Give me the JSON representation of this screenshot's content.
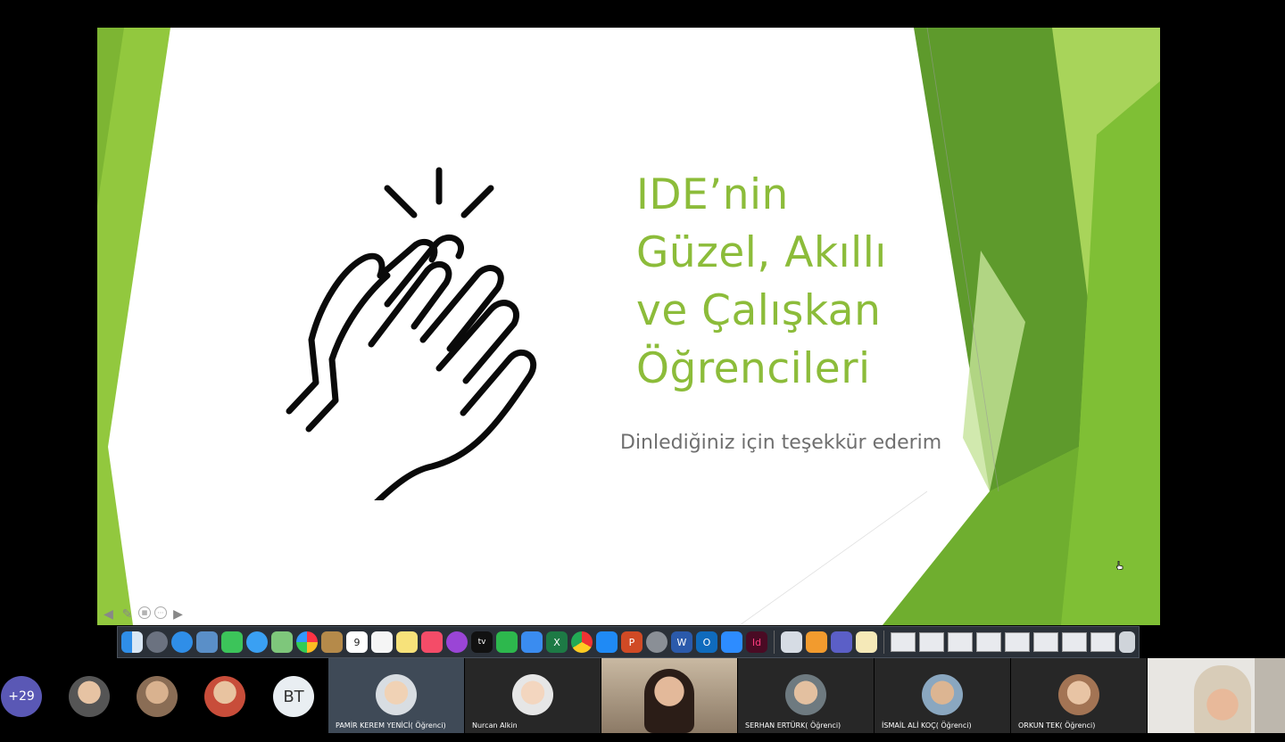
{
  "slide": {
    "title_lines": [
      "IDE’nin",
      "Güzel, Akıllı",
      "ve Çalışkan",
      "Öğrencileri"
    ],
    "subtitle": "Dinlediğiniz için teşekkür ederim",
    "accent_color": "#8cbc3a",
    "controls": [
      "arrow-left-icon",
      "pen-icon",
      "slides-grid-icon",
      "more-icon",
      "arrow-right-icon"
    ]
  },
  "dock": {
    "apps": [
      "finder",
      "launchpad",
      "safari",
      "preview",
      "facetime",
      "messages",
      "maps",
      "photos",
      "notes-book",
      "calendar",
      "reminders",
      "stickies",
      "music",
      "podcasts",
      "tv",
      "numbers",
      "keynote",
      "excel",
      "chrome",
      "app-store",
      "powerpoint",
      "system-preferences",
      "word",
      "outlook",
      "zoom",
      "indesign"
    ],
    "calendar_day": "9",
    "tv_label": "tv",
    "excel_label": "X",
    "word_label": "W",
    "outlook_label": "O",
    "powerpoint_label": "P",
    "indesign_label": "Id"
  },
  "participants": {
    "overflow_count": "+29",
    "initials": "BT",
    "tiles": [
      {
        "name": "PAMİR KEREM YENİCİ( Öğrenci)",
        "active": true
      },
      {
        "name": "Nurcan Alkin",
        "active": false
      },
      {
        "name": "",
        "video": true
      },
      {
        "name": "SERHAN ERTÜRK( Öğrenci)",
        "active": false
      },
      {
        "name": "İSMAİL ALİ KOÇ( Öğrenci)",
        "active": false
      },
      {
        "name": "ORKUN TEK( Öğrenci)",
        "active": false
      }
    ]
  }
}
